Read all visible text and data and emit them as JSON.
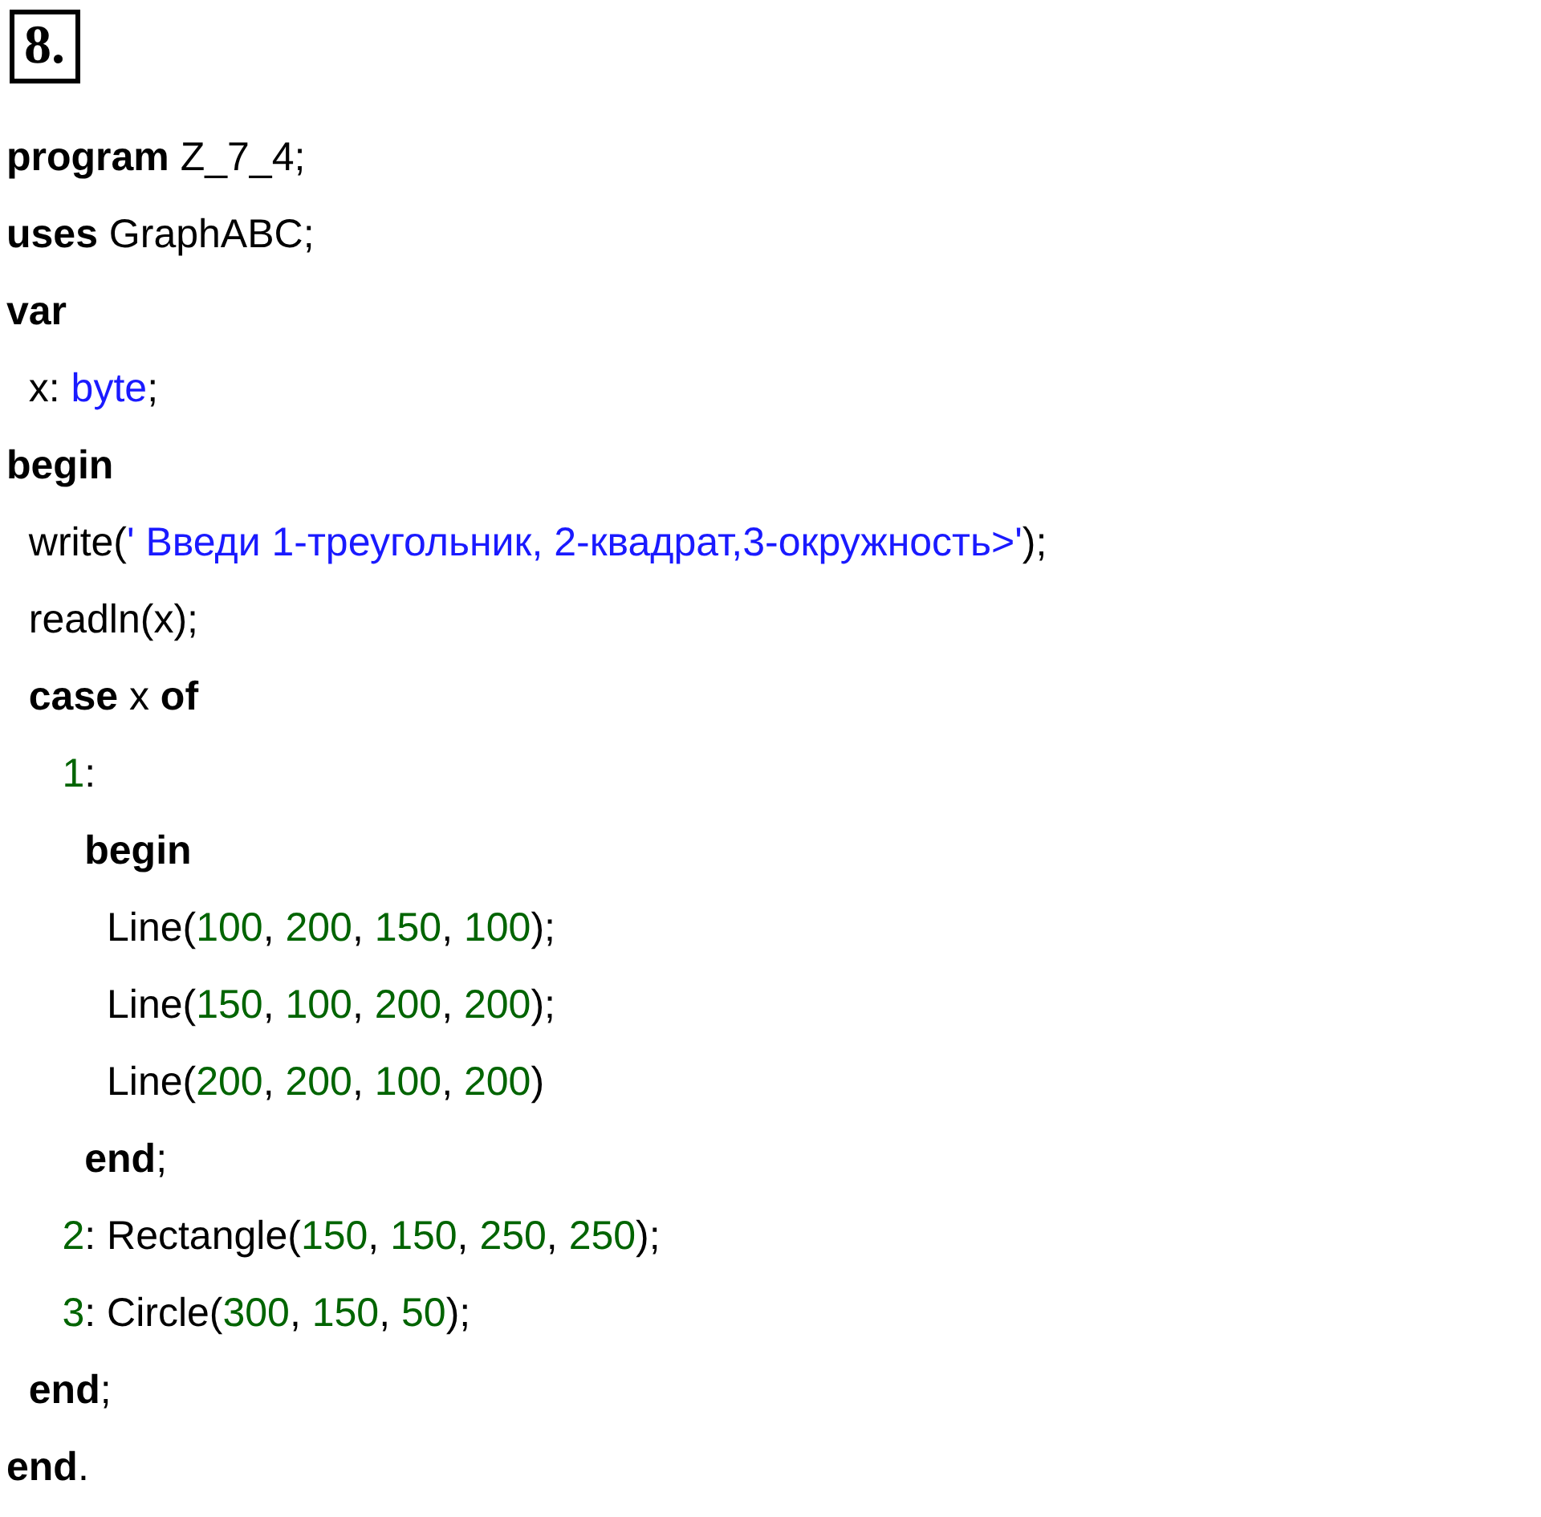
{
  "task_number": "8.",
  "code_lines": [
    [
      {
        "kind": "keyword",
        "text": "program"
      },
      {
        "kind": "plain",
        "text": " Z_7_4;"
      }
    ],
    [
      {
        "kind": "keyword",
        "text": "uses"
      },
      {
        "kind": "plain",
        "text": " GraphABC;"
      }
    ],
    [
      {
        "kind": "keyword",
        "text": "var"
      }
    ],
    [
      {
        "kind": "plain",
        "text": "  x: "
      },
      {
        "kind": "type",
        "text": "byte"
      },
      {
        "kind": "plain",
        "text": ";"
      }
    ],
    [
      {
        "kind": "keyword",
        "text": "begin"
      }
    ],
    [
      {
        "kind": "plain",
        "text": "  write("
      },
      {
        "kind": "string",
        "text": "' Введи 1-треугольник, 2-квадрат,3-окружность>'"
      },
      {
        "kind": "plain",
        "text": ");"
      }
    ],
    [
      {
        "kind": "plain",
        "text": "  readln(x);"
      }
    ],
    [
      {
        "kind": "keyword",
        "text": "  case"
      },
      {
        "kind": "plain",
        "text": " x "
      },
      {
        "kind": "keyword",
        "text": "of"
      }
    ],
    [
      {
        "kind": "number",
        "text": "     1"
      },
      {
        "kind": "plain",
        "text": ":"
      }
    ],
    [
      {
        "kind": "keyword",
        "text": "       begin"
      }
    ],
    [
      {
        "kind": "plain",
        "text": "         Line("
      },
      {
        "kind": "number",
        "text": "100"
      },
      {
        "kind": "plain",
        "text": ", "
      },
      {
        "kind": "number",
        "text": "200"
      },
      {
        "kind": "plain",
        "text": ", "
      },
      {
        "kind": "number",
        "text": "150"
      },
      {
        "kind": "plain",
        "text": ", "
      },
      {
        "kind": "number",
        "text": "100"
      },
      {
        "kind": "plain",
        "text": ");"
      }
    ],
    [
      {
        "kind": "plain",
        "text": "         Line("
      },
      {
        "kind": "number",
        "text": "150"
      },
      {
        "kind": "plain",
        "text": ", "
      },
      {
        "kind": "number",
        "text": "100"
      },
      {
        "kind": "plain",
        "text": ", "
      },
      {
        "kind": "number",
        "text": "200"
      },
      {
        "kind": "plain",
        "text": ", "
      },
      {
        "kind": "number",
        "text": "200"
      },
      {
        "kind": "plain",
        "text": ");"
      }
    ],
    [
      {
        "kind": "plain",
        "text": "         Line("
      },
      {
        "kind": "number",
        "text": "200"
      },
      {
        "kind": "plain",
        "text": ", "
      },
      {
        "kind": "number",
        "text": "200"
      },
      {
        "kind": "plain",
        "text": ", "
      },
      {
        "kind": "number",
        "text": "100"
      },
      {
        "kind": "plain",
        "text": ", "
      },
      {
        "kind": "number",
        "text": "200"
      },
      {
        "kind": "plain",
        "text": ")"
      }
    ],
    [
      {
        "kind": "keyword",
        "text": "       end"
      },
      {
        "kind": "plain",
        "text": ";"
      }
    ],
    [
      {
        "kind": "number",
        "text": "     2"
      },
      {
        "kind": "plain",
        "text": ": Rectangle("
      },
      {
        "kind": "number",
        "text": "150"
      },
      {
        "kind": "plain",
        "text": ", "
      },
      {
        "kind": "number",
        "text": "150"
      },
      {
        "kind": "plain",
        "text": ", "
      },
      {
        "kind": "number",
        "text": "250"
      },
      {
        "kind": "plain",
        "text": ", "
      },
      {
        "kind": "number",
        "text": "250"
      },
      {
        "kind": "plain",
        "text": ");"
      }
    ],
    [
      {
        "kind": "number",
        "text": "     3"
      },
      {
        "kind": "plain",
        "text": ": Circle("
      },
      {
        "kind": "number",
        "text": "300"
      },
      {
        "kind": "plain",
        "text": ", "
      },
      {
        "kind": "number",
        "text": "150"
      },
      {
        "kind": "plain",
        "text": ", "
      },
      {
        "kind": "number",
        "text": "50"
      },
      {
        "kind": "plain",
        "text": ");"
      }
    ],
    [
      {
        "kind": "keyword",
        "text": "  end"
      },
      {
        "kind": "plain",
        "text": ";"
      }
    ],
    [
      {
        "kind": "keyword",
        "text": "end"
      },
      {
        "kind": "plain",
        "text": "."
      }
    ]
  ]
}
